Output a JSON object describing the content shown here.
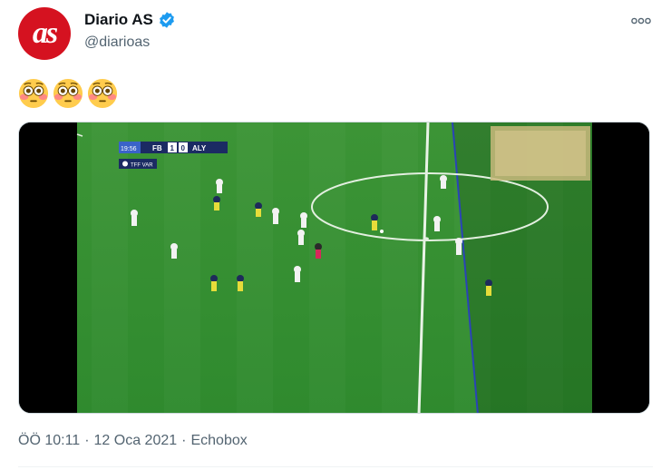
{
  "tweet": {
    "author": {
      "avatar_text": "as",
      "display_name": "Diario AS",
      "handle": "@diarioas",
      "verified": true
    },
    "emojis": [
      "flushed-face-icon",
      "flushed-face-icon",
      "flushed-face-icon"
    ],
    "media": {
      "scoreboard": {
        "time": "19:56",
        "home_team": "FB",
        "home_score": "1",
        "away_score": "0",
        "away_team": "ALY",
        "tag": "TFF VAR"
      }
    },
    "meta": {
      "time": "ÖÖ 10:11",
      "separator1": "·",
      "date": "12 Oca 2021",
      "separator2": "·",
      "source": "Echobox"
    }
  },
  "colors": {
    "brand_red": "#d51220",
    "verified_blue": "#1d9bf0",
    "pitch_green": "#3a8f34",
    "text_secondary": "#536471"
  }
}
